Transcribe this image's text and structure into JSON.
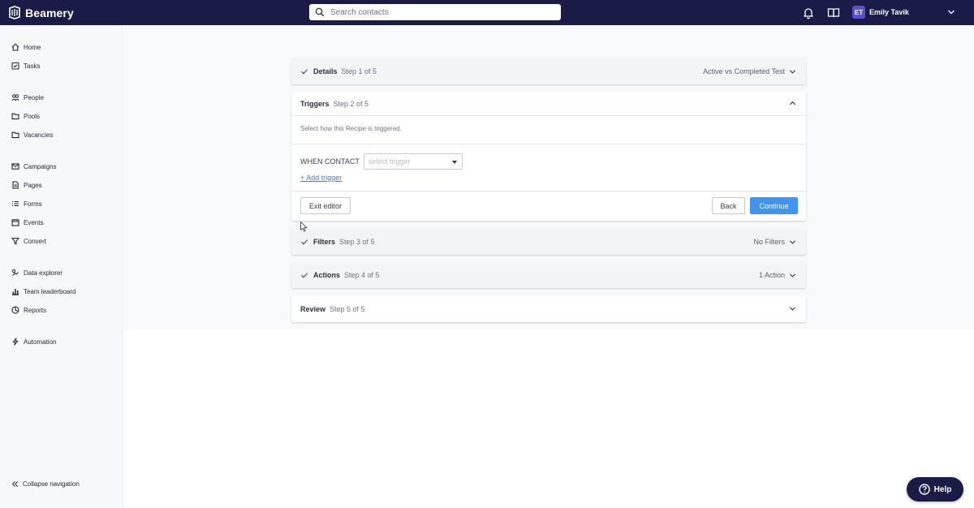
{
  "app": {
    "brand": "Beamery",
    "search_placeholder": "Search contacts"
  },
  "user": {
    "initials": "ET",
    "name": "Emily Tavik"
  },
  "sidebar": {
    "items": [
      {
        "label": "Home",
        "icon": "home-icon"
      },
      {
        "label": "Tasks",
        "icon": "tasks-icon"
      },
      {
        "label": "People",
        "icon": "people-icon"
      },
      {
        "label": "Pools",
        "icon": "folder-icon"
      },
      {
        "label": "Vacancies",
        "icon": "folder-icon"
      },
      {
        "label": "Campaigns",
        "icon": "mail-icon"
      },
      {
        "label": "Pages",
        "icon": "page-icon"
      },
      {
        "label": "Forms",
        "icon": "list-icon"
      },
      {
        "label": "Events",
        "icon": "calendar-icon"
      },
      {
        "label": "Convert",
        "icon": "filter-icon"
      },
      {
        "label": "Data explorer",
        "icon": "explorer-icon"
      },
      {
        "label": "Team leaderboard",
        "icon": "bar-chart-icon"
      },
      {
        "label": "Reports",
        "icon": "reports-icon"
      },
      {
        "label": "Automation",
        "icon": "lightning-icon"
      }
    ],
    "collapse_label": "Collapse navigation"
  },
  "steps": {
    "details": {
      "title": "Details",
      "step": "Step 1 of 5",
      "summary": "Active vs Completed Test"
    },
    "triggers": {
      "title": "Triggers",
      "step": "Step 2 of 5",
      "description": "Select how this Recipe is triggered.",
      "when_label": "WHEN CONTACT",
      "select_placeholder": "select trigger",
      "add_trigger": "+ Add trigger",
      "exit_label": "Exit editor",
      "back_label": "Back",
      "continue_label": "Continue"
    },
    "filters": {
      "title": "Filters",
      "step": "Step 3 of 5",
      "summary": "No Filters"
    },
    "actions": {
      "title": "Actions",
      "step": "Step 4 of 5",
      "summary": "1 Action"
    },
    "review": {
      "title": "Review",
      "step": "Step 5 of 5"
    }
  },
  "help": {
    "label": "Help"
  },
  "colors": {
    "topbar": "#1b1b47",
    "accent": "#3f94f0",
    "link": "#3d7fd8",
    "avatar": "#5a4fcf"
  }
}
